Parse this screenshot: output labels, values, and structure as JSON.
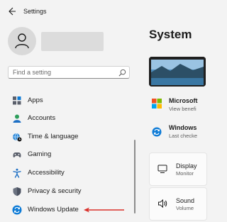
{
  "window": {
    "title": "Settings"
  },
  "user": {
    "avatar_icon": "person-icon"
  },
  "search": {
    "placeholder": "Find a setting",
    "value": ""
  },
  "sidebar": {
    "items": [
      {
        "label": "Apps",
        "icon": "apps-icon"
      },
      {
        "label": "Accounts",
        "icon": "accounts-icon"
      },
      {
        "label": "Time & language",
        "icon": "globe-clock-icon"
      },
      {
        "label": "Gaming",
        "icon": "controller-icon"
      },
      {
        "label": "Accessibility",
        "icon": "accessibility-icon"
      },
      {
        "label": "Privacy & security",
        "icon": "shield-icon"
      },
      {
        "label": "Windows Update",
        "icon": "update-sync-icon"
      }
    ]
  },
  "main": {
    "title": "System",
    "info_rows": [
      {
        "title": "Microsoft",
        "subtitle": "View benefi",
        "icon": "microsoft-logo-icon"
      },
      {
        "title": "Windows",
        "subtitle": "Last checke",
        "icon": "update-sync-icon"
      }
    ],
    "cards": [
      {
        "title": "Display",
        "subtitle": "Monitor",
        "icon": "monitor-icon"
      },
      {
        "title": "Sound",
        "subtitle": "Volume",
        "icon": "speaker-icon"
      }
    ]
  },
  "annotation": {
    "arrow_color": "#d9312b"
  },
  "colors": {
    "accent": "#0067c0",
    "background": "#f3f3f3"
  }
}
